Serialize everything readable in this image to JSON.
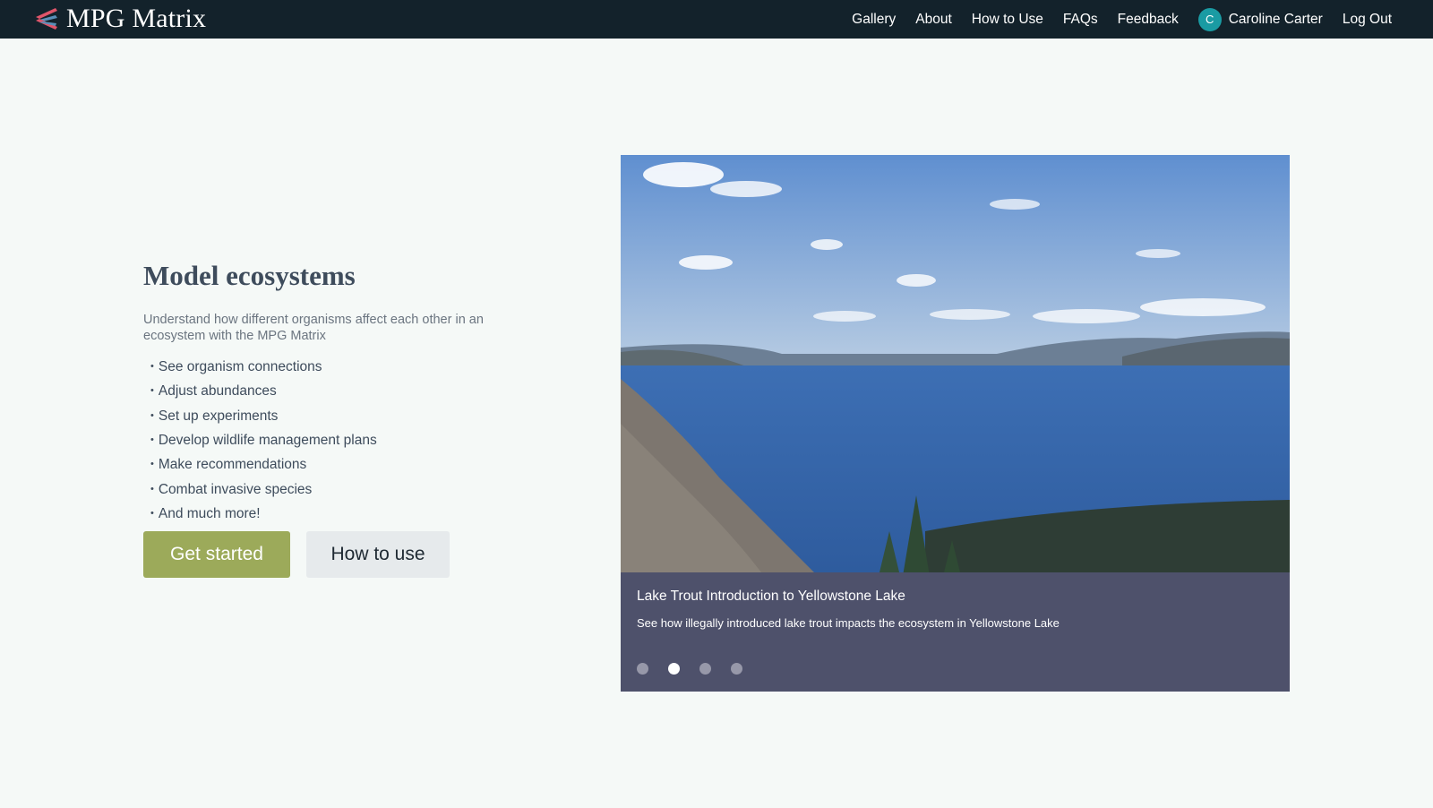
{
  "brand": {
    "name": "MPG Matrix",
    "logo_icon": "chevron-stripes-logo-icon",
    "colors": {
      "nav_bg": "#13222b",
      "logo_red": "#e0556a",
      "logo_blue": "#5a8fb8"
    }
  },
  "nav": {
    "links": [
      "Gallery",
      "About",
      "How to Use",
      "FAQs",
      "Feedback"
    ],
    "user": {
      "initial": "C",
      "name": "Caroline Carter",
      "avatar_color": "#1a9ba3"
    },
    "logout": "Log Out"
  },
  "hero": {
    "title": "Model ecosystems",
    "subtitle": "Understand how different organisms affect each other in an ecosystem with the MPG Matrix",
    "features": [
      "See organism connections",
      "Adjust abundances",
      "Set up experiments",
      "Develop wildlife management plans",
      "Make recommendations",
      "Combat invasive species",
      "And much more!"
    ],
    "primary_button": "Get started",
    "secondary_button": "How to use",
    "colors": {
      "primary": "#9caa5a",
      "secondary": "#e6eaec"
    }
  },
  "carousel": {
    "slide_title": "Lake Trout Introduction to Yellowstone Lake",
    "slide_description": "See how illegally introduced lake trout impacts the ecosystem in Yellowstone Lake",
    "slide_count": 4,
    "active_index": 1
  }
}
